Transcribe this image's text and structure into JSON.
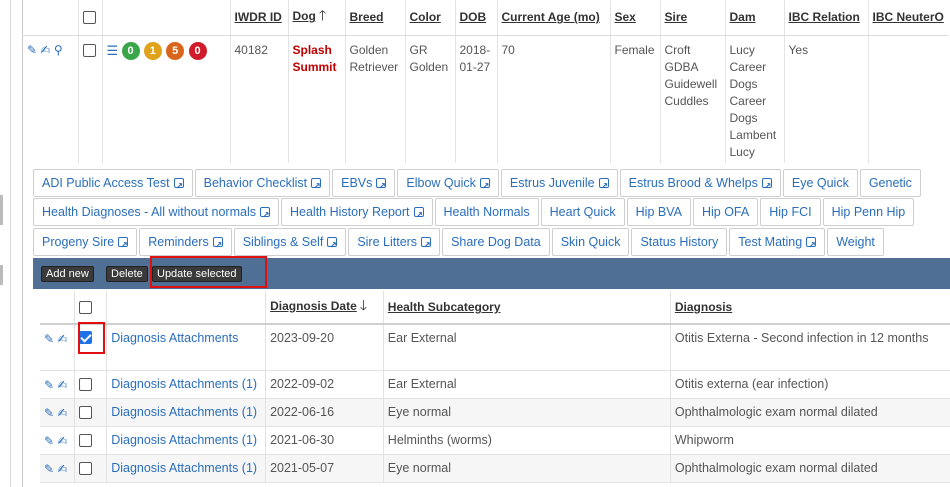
{
  "top_table": {
    "headers": [
      "IWDR ID",
      "Dog",
      "Breed",
      "Color",
      "DOB",
      "Current Age (mo)",
      "Sex",
      "Sire",
      "Dam",
      "IBC Relation",
      "IBC NeuterO"
    ],
    "row": {
      "badges": [
        {
          "value": "0",
          "color": "#3aa64a"
        },
        {
          "value": "1",
          "color": "#e0a21a"
        },
        {
          "value": "5",
          "color": "#d9651c"
        },
        {
          "value": "0",
          "color": "#d01c2a"
        }
      ],
      "iwdr_id": "40182",
      "dog_line1": "Splash",
      "dog_line2": "Summit",
      "breed_line1": "Golden",
      "breed_line2": "Retriever",
      "color_line1": "GR",
      "color_line2": "Golden",
      "dob_line1": "2018-",
      "dob_line2": "01-27",
      "age": "70",
      "sex": "Female",
      "sire_lines": [
        "Croft",
        "GDBA",
        "Guidewell",
        "Cuddles"
      ],
      "dam_lines": [
        "Lucy",
        "Career",
        "Dogs",
        "Career",
        "Dogs",
        "Lambent",
        "Lucy"
      ],
      "ibc_relation": "Yes",
      "ibc_neutero": ""
    }
  },
  "tabs": {
    "row1": [
      "ADI Public Access Test",
      "Behavior Checklist",
      "EBVs",
      "Elbow Quick",
      "Estrus Juvenile",
      "Estrus Brood & Whelps",
      "Eye Quick",
      "Genetic"
    ],
    "row2": [
      "Health Diagnoses - All without normals",
      "Health History Report",
      "Health Normals",
      "Heart Quick",
      "Hip BVA",
      "Hip OFA",
      "Hip FCI",
      "Hip Penn Hip"
    ],
    "row3": [
      "Progeny Sire",
      "Reminders",
      "Siblings & Self",
      "Sire Litters",
      "Share Dog Data",
      "Skin Quick",
      "Status History",
      "Test Mating",
      "Weight"
    ]
  },
  "toolbar": {
    "add_new": "Add new",
    "delete": "Delete",
    "update_selected": "Update selected"
  },
  "grid": {
    "headers": {
      "date": "Diagnosis Date",
      "subcategory": "Health Subcategory",
      "diagnosis": "Diagnosis"
    },
    "rows": [
      {
        "checked": true,
        "attachment": "Diagnosis Attachments",
        "date": "2023-09-20",
        "subcategory": "Ear External",
        "diagnosis": "Otitis Externa - Second infection in 12 months"
      },
      {
        "checked": false,
        "attachment": "Diagnosis Attachments (1)",
        "date": "2022-09-02",
        "subcategory": "Ear External",
        "diagnosis": "Otitis externa (ear infection)"
      },
      {
        "checked": false,
        "attachment": "Diagnosis Attachments (1)",
        "date": "2022-06-16",
        "subcategory": "Eye normal",
        "diagnosis": "Ophthalmologic exam normal dilated"
      },
      {
        "checked": false,
        "attachment": "Diagnosis Attachments (1)",
        "date": "2021-06-30",
        "subcategory": "Helminths (worms)",
        "diagnosis": "Whipworm"
      },
      {
        "checked": false,
        "attachment": "Diagnosis Attachments (1)",
        "date": "2021-05-07",
        "subcategory": "Eye normal",
        "diagnosis": "Ophthalmologic exam normal dilated"
      }
    ]
  }
}
